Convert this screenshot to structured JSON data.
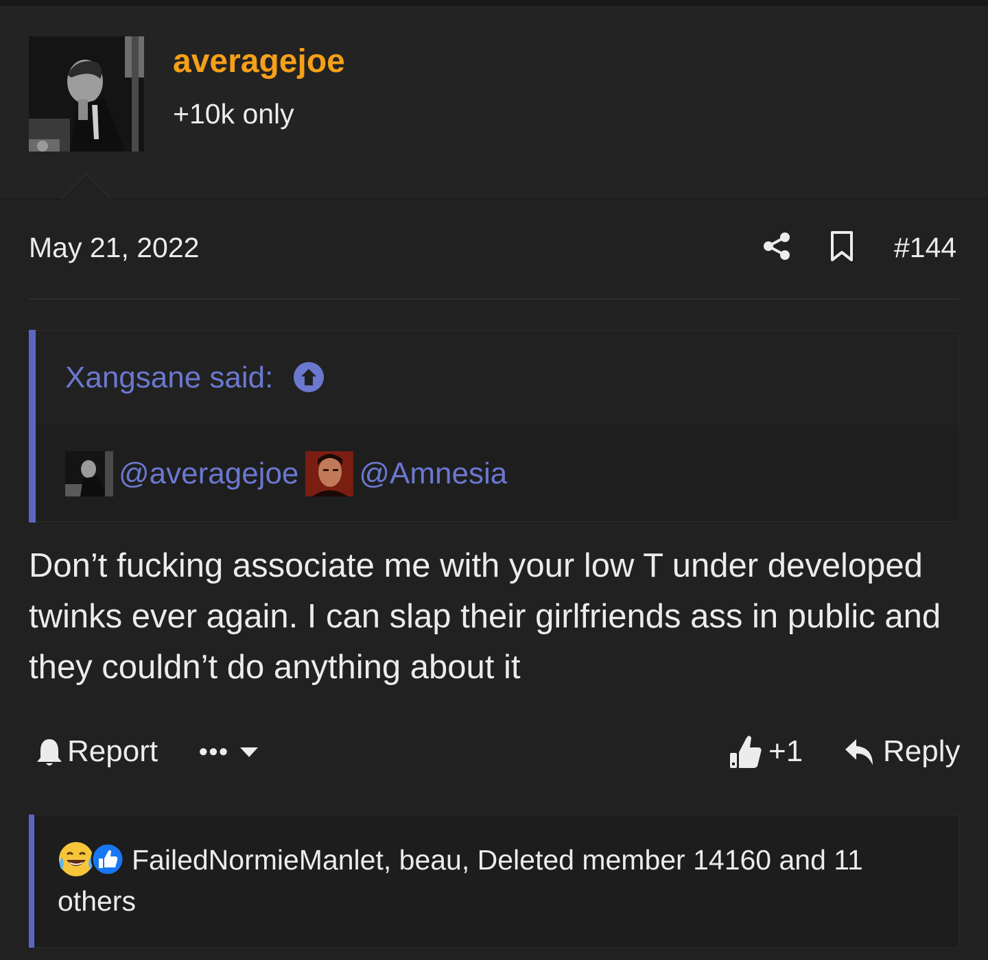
{
  "header": {
    "username": "averagejoe",
    "user_title": "+10k only"
  },
  "post": {
    "date": "May 21, 2022",
    "number": "#144",
    "body": "Don’t fucking associate me with your low T under developed twinks ever again. I can slap their girlfriends ass in public and they couldn’t do anything about it"
  },
  "quote": {
    "author_label": "Xangsane said:",
    "mentions": [
      "@averagejoe",
      "@Amnesia"
    ]
  },
  "actions": {
    "report_label": "Report",
    "more_label": "•••",
    "like_count": "+1",
    "reply_label": "Reply"
  },
  "reactions": {
    "text": "FailedNormieManlet, beau, Deleted member 14160 and 11 others"
  },
  "colors": {
    "background": "#212121",
    "username": "#f6a018",
    "link": "#6b78d0",
    "quote_bar": "#5c67c4",
    "text": "#ececec"
  },
  "icons": {
    "share": "share-icon",
    "bookmark": "bookmark-icon",
    "quote_jump": "arrow-up-circle-icon",
    "report": "bell-icon",
    "more": "ellipsis-icon",
    "caret": "caret-down-icon",
    "like": "thumbs-up-icon",
    "reply": "reply-arrow-icon",
    "reaction_1": "laughing-tears-emoji",
    "reaction_2": "like-reaction-icon"
  }
}
